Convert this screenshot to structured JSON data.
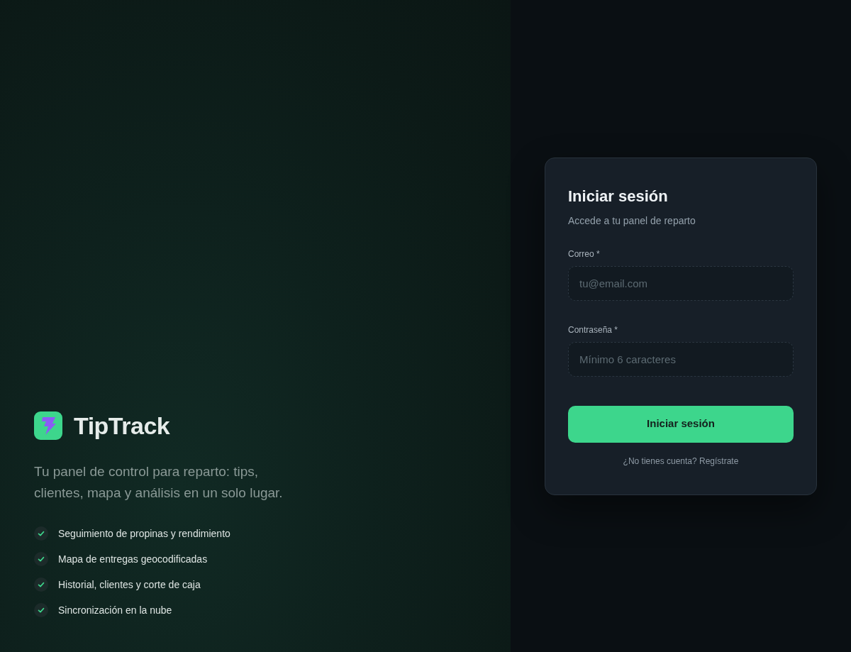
{
  "brand": {
    "name": "TipTrack"
  },
  "tagline": "Tu panel de control para reparto: tips, clientes, mapa y análisis en un solo lugar.",
  "features": [
    "Seguimiento de propinas y rendimiento",
    "Mapa de entregas geocodificadas",
    "Historial, clientes y corte de caja",
    "Sincronización en la nube"
  ],
  "login_card": {
    "title": "Iniciar sesión",
    "subtitle": "Accede a tu panel de reparto",
    "fields": [
      {
        "label": "Correo *",
        "placeholder": "tu@email.com"
      },
      {
        "label": "Contraseña *",
        "placeholder": "Mínimo 6 caracteres"
      }
    ],
    "submit_button": "Iniciar sesión",
    "signup_link": "¿No tienes cuenta? Regístrate"
  }
}
